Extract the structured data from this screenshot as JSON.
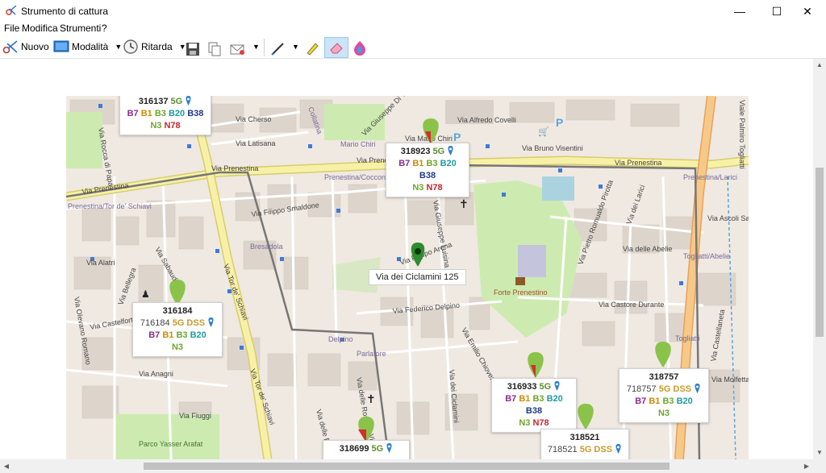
{
  "window": {
    "title": "Strumento di cattura",
    "minimize": "—",
    "maximize": "☐",
    "close": "✕"
  },
  "menu": [
    "File",
    "Modifica",
    "Strumenti",
    "?"
  ],
  "toolbar": {
    "new_label": "Nuovo",
    "mode_label": "Modalità",
    "delay_label": "Ritarda"
  },
  "map": {
    "address": "Via dei Ciclamini 125",
    "streets": [
      "Via Prenestina",
      "Via Prenestina",
      "Via Prenestina",
      "Via Prenestina",
      "Via Filippo Smaldone",
      "Via Tor de' Schiavi",
      "Via Tor de' Schiavi",
      "Via Federico Delpino",
      "Via Emilio Chiovenda",
      "Via Pietro Romualdo Pirotta",
      "Via Castore Durante",
      "Via delle Rose",
      "Via dei Ciclamini",
      "Via Anagni",
      "Via Fiuggi",
      "Via Alatri",
      "Via Castelforte",
      "Via Olevano Romano",
      "Via Sabaudia",
      "Via dei Larici",
      "Via delle Abelie",
      "Via Ascoli Satriano",
      "Via Castellaneta",
      "Via Molfetta",
      "Via Alfredo Covelli",
      "Via Bruno Visentini",
      "Via Mario Chiri",
      "Via Cherso",
      "Via Latisana",
      "Via Giuseppe Di Vittorio",
      "Viale Palmiro Togliatti",
      "Via Giuseppe Luisina",
      "Via delle Ortensie",
      "Via delle Betulle",
      "Via Filippo Arena",
      "Via Bellegra",
      "Via Rocca di Papa"
    ],
    "places": [
      "Prenestina/Tor de' Schiavi",
      "Prenestina/Cocconi",
      "Prenestina/Larici",
      "Bresadola",
      "Delpino",
      "Parlatore",
      "Forte Prenestino",
      "Togliatti/Abelie",
      "Togliatti",
      "Parco Yasser Arafat",
      "Mario Chiri",
      "Collatina"
    ],
    "cards": [
      {
        "id": "316137",
        "tech": "5G",
        "bands": [
          "B7",
          "B1",
          "B3",
          "B20",
          "B38"
        ],
        "nr": [
          "N3",
          "N78"
        ]
      },
      {
        "id": "318923",
        "tech": "5G",
        "bands": [
          "B7",
          "B1",
          "B3",
          "B20",
          "B38"
        ],
        "nr": [
          "N3",
          "N78"
        ]
      },
      {
        "id": "316184",
        "sub": "716184",
        "tech": "5G DSS",
        "bands": [
          "B7",
          "B1",
          "B3",
          "B20"
        ],
        "nr": [
          "N3"
        ]
      },
      {
        "id": "316933",
        "tech": "5G",
        "bands": [
          "B7",
          "B1",
          "B3",
          "B20",
          "B38"
        ],
        "nr": [
          "N3",
          "N78"
        ]
      },
      {
        "id": "318757",
        "sub": "718757",
        "tech": "5G DSS",
        "bands": [
          "B7",
          "B1",
          "B3",
          "B20"
        ],
        "nr": [
          "N3"
        ]
      },
      {
        "id": "318521",
        "sub": "718521",
        "tech": "5G DSS",
        "bands": [],
        "nr": []
      },
      {
        "id": "318699",
        "tech": "5G",
        "bands": [],
        "nr": []
      }
    ]
  },
  "colors": {
    "road_major": "#f7f1a8",
    "road_major_border": "#d9cc6a",
    "background": "#efe9e1",
    "park": "#cdebb0",
    "block": "#e0d8d0",
    "tram": "#777777"
  }
}
